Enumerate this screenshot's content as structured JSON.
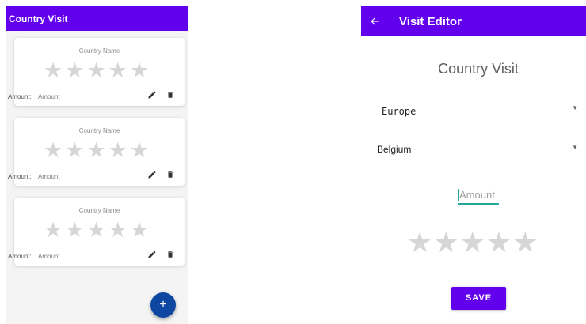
{
  "left_screen": {
    "title": "Country Visit",
    "cards": [
      {
        "country_placeholder": "Country Name",
        "amount_label": "Amount:",
        "amount_placeholder": "Amount",
        "rating": 0
      },
      {
        "country_placeholder": "Country Name",
        "amount_label": "Amount:",
        "amount_placeholder": "Amount",
        "rating": 0
      },
      {
        "country_placeholder": "Country Name",
        "amount_label": "Amount:",
        "amount_placeholder": "Amount",
        "rating": 0
      }
    ],
    "fab_label": "+",
    "star_glyph": "★",
    "icons": {
      "edit": "pencil-icon",
      "delete": "trash-icon",
      "add": "plus-icon"
    }
  },
  "right_screen": {
    "title": "Visit Editor",
    "heading": "Country Visit",
    "region_select": {
      "value": "Europe",
      "arrow": "▼"
    },
    "country_select": {
      "value": "Belgium",
      "arrow": "▼"
    },
    "amount_input": {
      "placeholder": "Amount",
      "value": ""
    },
    "rating": 0,
    "save_label": "SAVE",
    "icons": {
      "back": "arrow-back-icon"
    }
  },
  "colors": {
    "primary": "#6200ee",
    "fab": "#0d47a1",
    "accent": "#26a69a",
    "star_empty": "#d6d6d6"
  }
}
